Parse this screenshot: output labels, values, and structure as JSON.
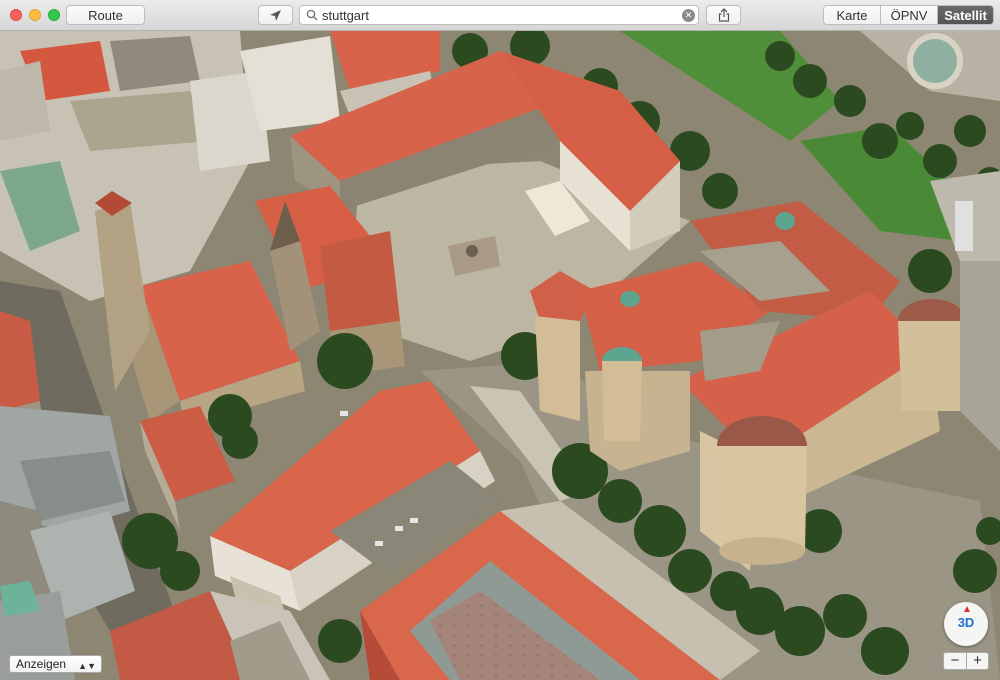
{
  "toolbar": {
    "route_label": "Route",
    "search_value": "stuttgart",
    "view_modes": [
      "Karte",
      "ÖPNV",
      "Satellit"
    ],
    "active_view": "Satellit"
  },
  "map": {
    "display_select_value": "Anzeigen",
    "compass_label": "3D",
    "zoom_out_label": "−",
    "zoom_in_label": "+"
  },
  "colors": {
    "roof": "#d8654a",
    "roof_dark": "#b04a33",
    "stone": "#d9c7a2",
    "plaza": "#b9b3a0",
    "grass": "#4d8a3a",
    "tree": "#2f4f22"
  }
}
